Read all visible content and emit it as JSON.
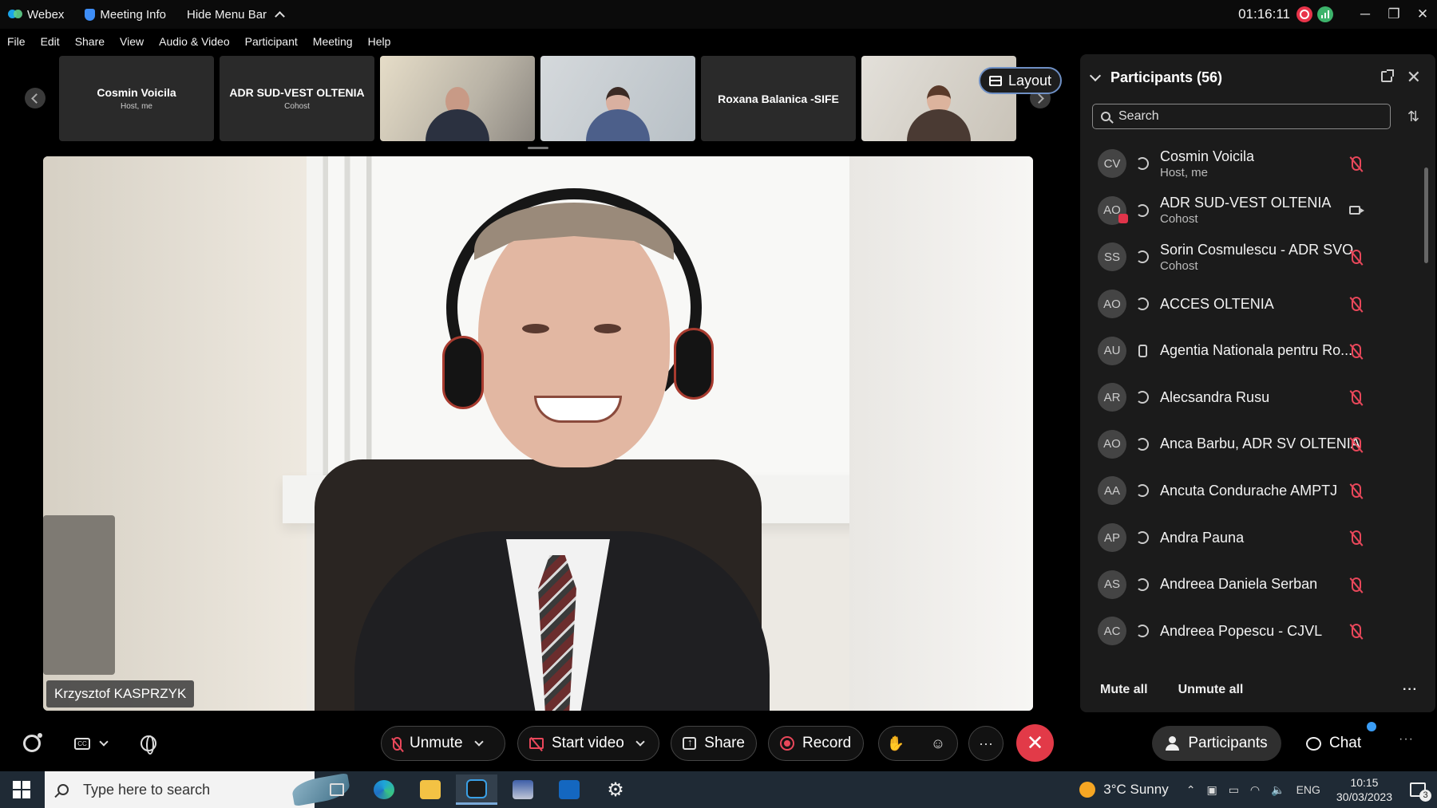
{
  "titlebar": {
    "app_name": "Webex",
    "meeting_info": "Meeting Info",
    "hide_menu": "Hide Menu Bar",
    "timer": "01:16:11"
  },
  "menu": [
    "File",
    "Edit",
    "Share",
    "View",
    "Audio & Video",
    "Participant",
    "Meeting",
    "Help"
  ],
  "thumbnails": [
    {
      "name": "Cosmin Voicila",
      "sub": "Host, me",
      "video": false
    },
    {
      "name": "ADR SUD-VEST OLTENIA",
      "sub": "Cohost",
      "video": false
    },
    {
      "name": "",
      "sub": "",
      "video": true
    },
    {
      "name": "",
      "sub": "",
      "video": true
    },
    {
      "name": "Roxana Balanica -SIFE",
      "sub": "",
      "video": false
    },
    {
      "name": "",
      "sub": "",
      "video": true
    }
  ],
  "layout_button": "Layout",
  "main_video": {
    "speaker": "Krzysztof KASPRZYK"
  },
  "panel": {
    "title": "Participants (56)",
    "search_placeholder": "Search",
    "participants": [
      {
        "initials": "CV",
        "name": "Cosmin Voicila",
        "role": "Host, me",
        "device": "computer",
        "status": "muted"
      },
      {
        "initials": "AO",
        "name": "ADR SUD-VEST OLTENIA",
        "role": "Cohost",
        "device": "computer",
        "status": "video",
        "badge": true
      },
      {
        "initials": "SS",
        "name": "Sorin Cosmulescu - ADR SVO",
        "role": "Cohost",
        "device": "computer",
        "status": "muted"
      },
      {
        "initials": "AO",
        "name": "ACCES OLTENIA",
        "role": "",
        "device": "computer",
        "status": "muted"
      },
      {
        "initials": "AU",
        "name": "Agentia Nationala pentru Ro...",
        "role": "",
        "device": "phone",
        "status": "muted"
      },
      {
        "initials": "AR",
        "name": "Alecsandra Rusu",
        "role": "",
        "device": "computer",
        "status": "muted"
      },
      {
        "initials": "AO",
        "name": "Anca Barbu, ADR SV OLTENIA",
        "role": "",
        "device": "computer",
        "status": "muted"
      },
      {
        "initials": "AA",
        "name": "Ancuta Condurache AMPTJ",
        "role": "",
        "device": "computer",
        "status": "muted"
      },
      {
        "initials": "AP",
        "name": "Andra Pauna",
        "role": "",
        "device": "computer",
        "status": "muted"
      },
      {
        "initials": "AS",
        "name": "Andreea Daniela Serban",
        "role": "",
        "device": "computer",
        "status": "muted"
      },
      {
        "initials": "AC",
        "name": "Andreea Popescu - CJVL",
        "role": "",
        "device": "computer",
        "status": "muted"
      }
    ],
    "mute_all": "Mute all",
    "unmute_all": "Unmute all"
  },
  "controls": {
    "unmute": "Unmute",
    "start_video": "Start video",
    "share": "Share",
    "record": "Record",
    "participants": "Participants",
    "chat": "Chat"
  },
  "taskbar": {
    "search_placeholder": "Type here to search",
    "weather": "3°C  Sunny",
    "lang": "ENG",
    "time": "10:15",
    "date": "30/03/2023",
    "notifications": "3"
  },
  "colors": {
    "accent_red": "#e23a48",
    "recording_red": "#e8344a",
    "panel_bg": "#1b1b1b"
  }
}
